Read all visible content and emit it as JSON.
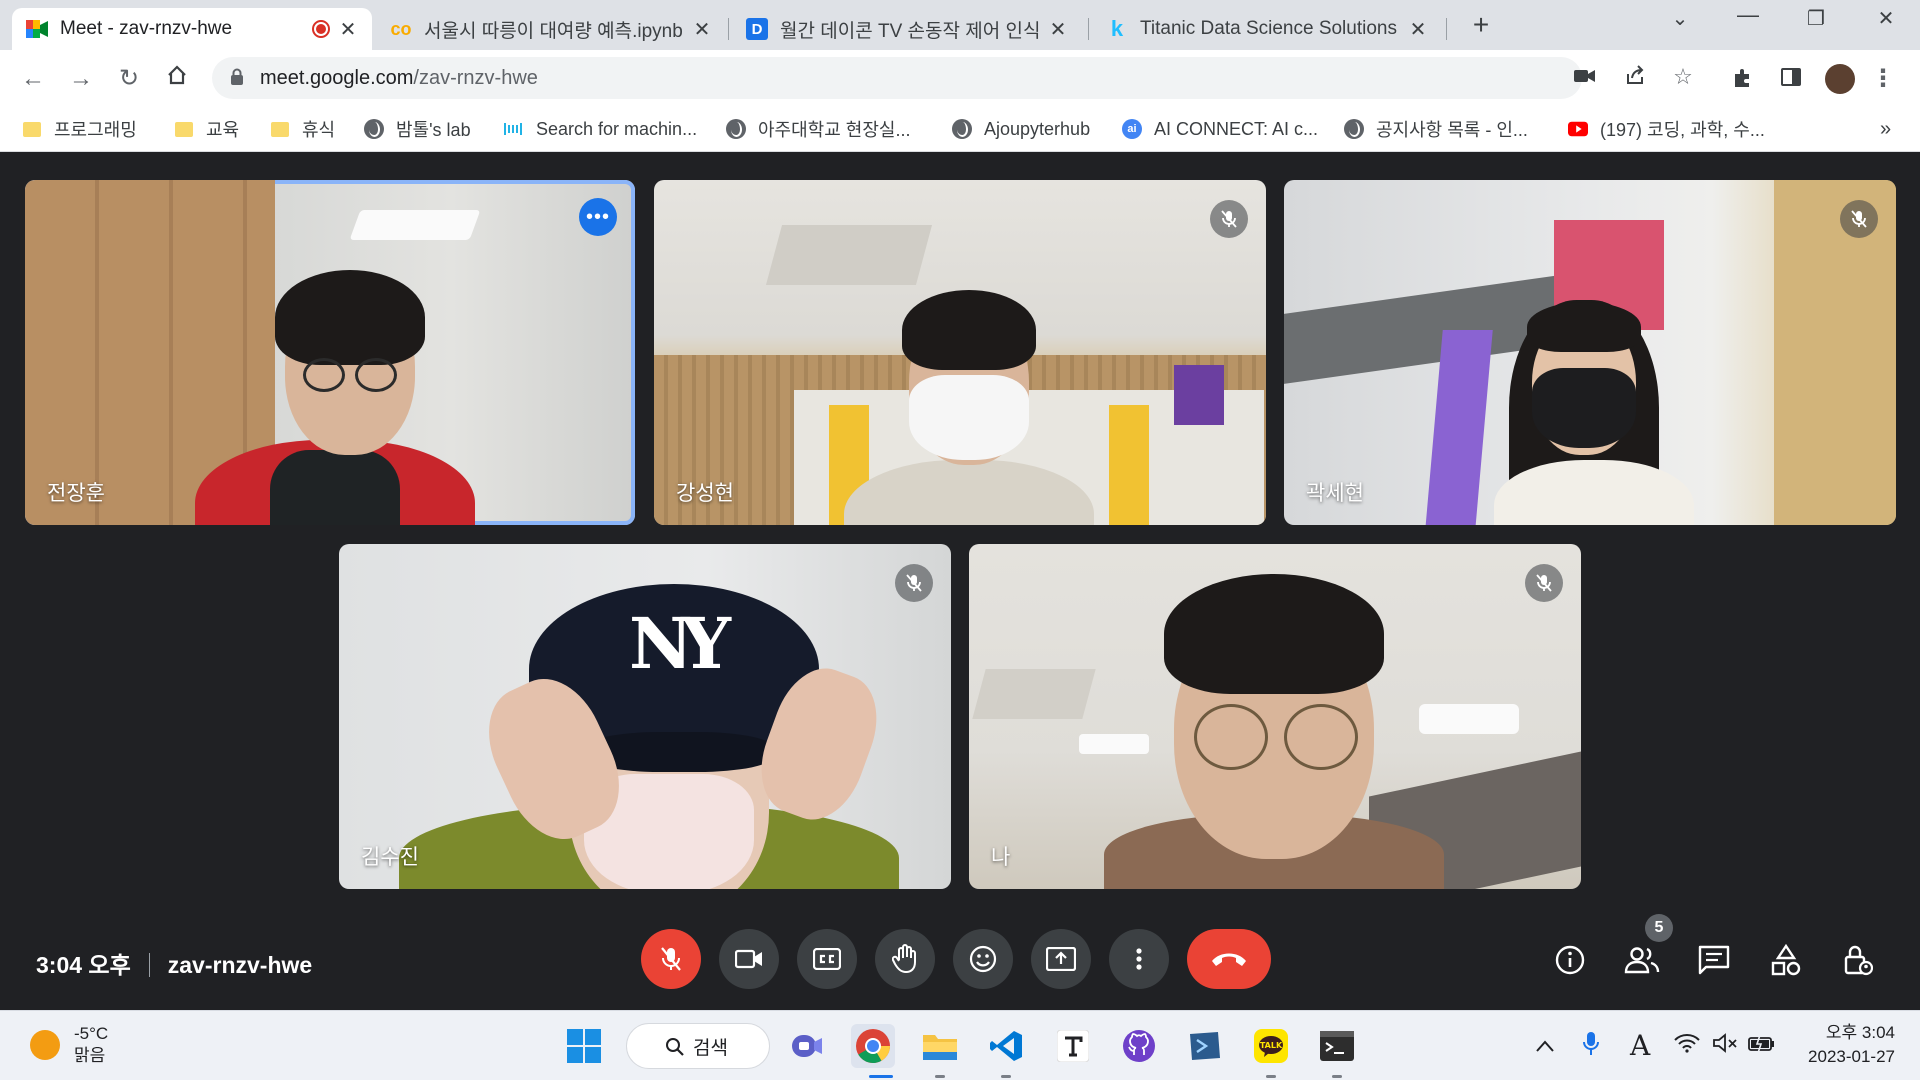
{
  "browser": {
    "tabs": [
      {
        "title": "Meet - zav-rnzv-hwe",
        "recording": true,
        "active": true
      },
      {
        "title": "서울시 따릉이 대여량 예측.ipynb",
        "active": false
      },
      {
        "title": "월간 데이콘 TV 손동작 제어 인식",
        "active": false
      },
      {
        "title": "Titanic Data Science Solutions |",
        "active": false
      }
    ],
    "url_host": "meet.google.com",
    "url_path": "/zav-rnzv-hwe",
    "bookmarks": [
      {
        "label": "프로그래밍",
        "icon": "folder-icon"
      },
      {
        "label": "교육",
        "icon": "folder-icon"
      },
      {
        "label": "휴식",
        "icon": "folder-icon"
      },
      {
        "label": "밤톨's lab",
        "icon": "globe-icon"
      },
      {
        "label": "Search for machin...",
        "icon": "paperswithcode-icon"
      },
      {
        "label": "아주대학교 현장실...",
        "icon": "globe-icon"
      },
      {
        "label": "Ajoupyterhub",
        "icon": "globe-icon"
      },
      {
        "label": "AI CONNECT: AI c...",
        "icon": "ai-connect-icon"
      },
      {
        "label": "공지사항 목록 - 인...",
        "icon": "globe-icon"
      },
      {
        "label": "(197) 코딩, 과학, 수...",
        "icon": "youtube-icon"
      }
    ],
    "more_bookmarks": "»"
  },
  "meet": {
    "participants": [
      {
        "name": "전장훈",
        "muted": false,
        "speaking": true
      },
      {
        "name": "강성현",
        "muted": true,
        "speaking": false
      },
      {
        "name": "곽세현",
        "muted": true,
        "speaking": false
      },
      {
        "name": "김수진",
        "muted": true,
        "speaking": false
      },
      {
        "name": "나",
        "muted": true,
        "speaking": false
      }
    ],
    "time": "3:04 오후",
    "meeting_code": "zav-rnzv-hwe",
    "people_count": "5",
    "cap_logo_text": "NY"
  },
  "taskbar": {
    "temperature": "-5°C",
    "weather": "맑음",
    "search_label": "검색",
    "time": "오후 3:04",
    "date": "2023-01-27",
    "ime": "A"
  },
  "colors": {
    "meet_bg": "#202124",
    "speaking_outline": "#8ab4f8",
    "end_call": "#ea4335",
    "tab_strip": "#dee1e6"
  }
}
